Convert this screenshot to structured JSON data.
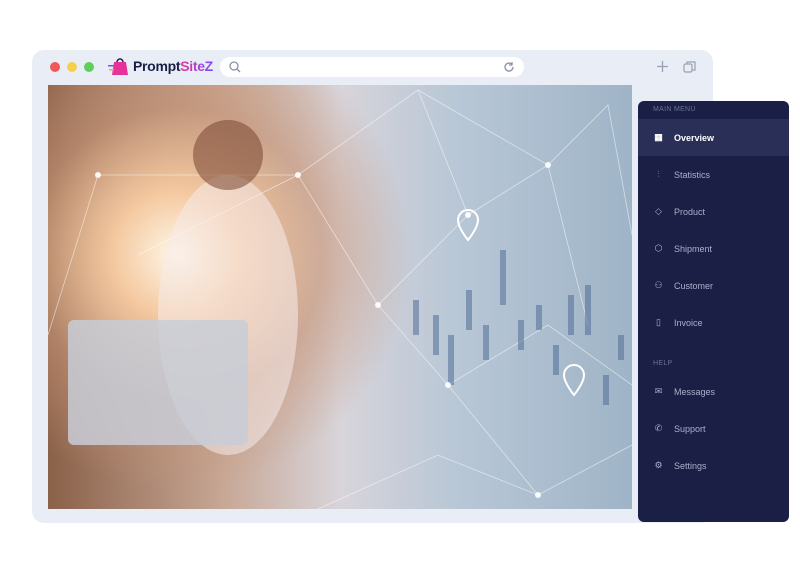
{
  "browser": {
    "logo_text_1": "Prompt",
    "logo_text_2": "SiteZ",
    "search_value": "",
    "dots": [
      "#f25656",
      "#f6d04d",
      "#5fce5a"
    ]
  },
  "sidebar": {
    "main_menu_label": "MAIN MENU",
    "help_label": "HELP",
    "items": [
      {
        "label": "Overview",
        "icon": "grid-icon",
        "active": true
      },
      {
        "label": "Statistics",
        "icon": "bar-chart-icon"
      },
      {
        "label": "Product",
        "icon": "tag-icon"
      },
      {
        "label": "Shipment",
        "icon": "box-icon"
      },
      {
        "label": "Customer",
        "icon": "users-icon"
      },
      {
        "label": "Invoice",
        "icon": "clipboard-icon"
      }
    ],
    "help_items": [
      {
        "label": "Messages",
        "icon": "mail-icon"
      },
      {
        "label": "Support",
        "icon": "phone-icon"
      },
      {
        "label": "Settings",
        "icon": "gear-icon"
      }
    ]
  },
  "colors": {
    "sidebar_bg": "#1b1f45",
    "window_bg": "#e9eef6"
  }
}
